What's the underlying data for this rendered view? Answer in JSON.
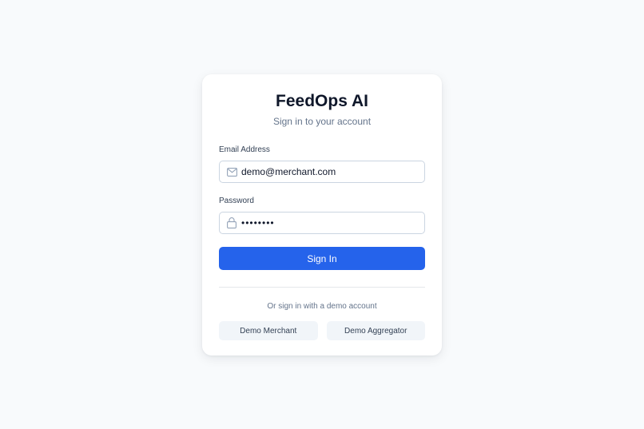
{
  "app": {
    "title": "FeedOps AI",
    "subtitle": "Sign in to your account"
  },
  "form": {
    "email": {
      "label": "Email Address",
      "value": "demo@merchant.com",
      "icon": "mail-icon"
    },
    "password": {
      "label": "Password",
      "value": "password",
      "icon": "lock-icon"
    },
    "submit_label": "Sign In"
  },
  "demo": {
    "prompt": "Or sign in with a demo account",
    "buttons": [
      {
        "label": "Demo Merchant"
      },
      {
        "label": "Demo Aggregator"
      }
    ]
  },
  "colors": {
    "accent": "#2563eb",
    "background": "#f8fafc",
    "card": "#ffffff",
    "muted_text": "#64748b"
  }
}
